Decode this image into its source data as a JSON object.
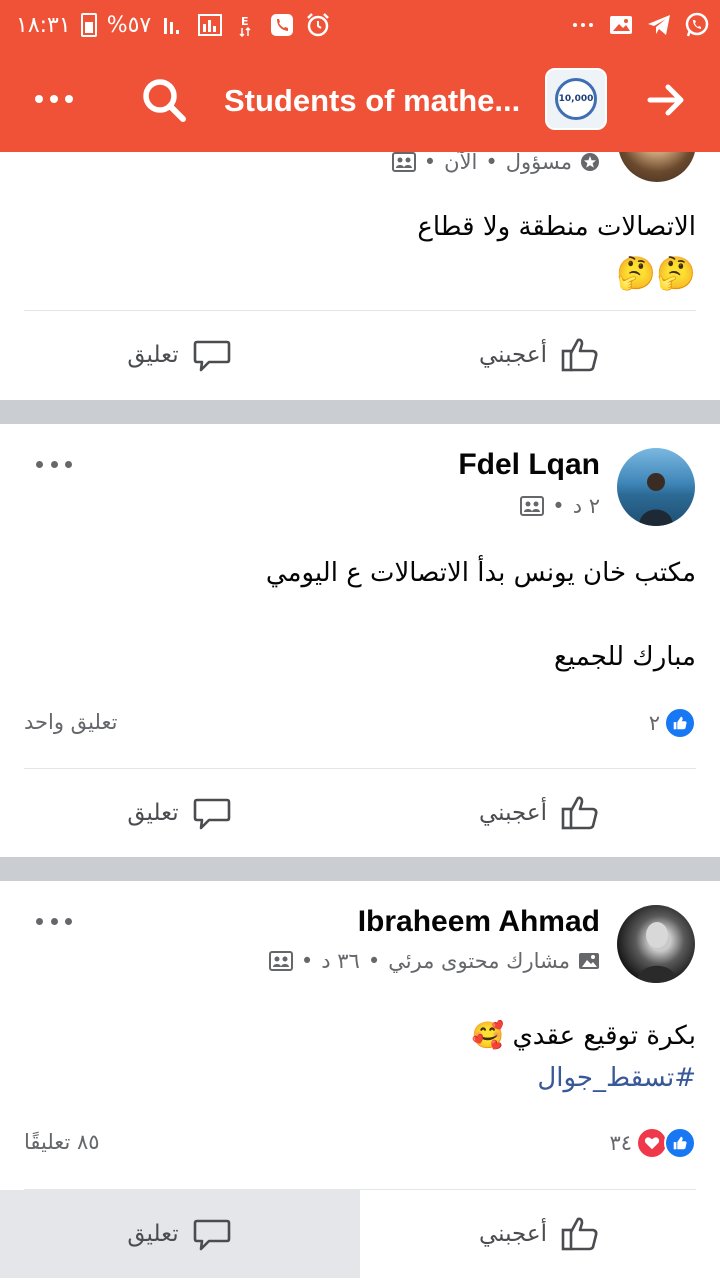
{
  "status_bar": {
    "time": "١٨:٣١",
    "battery": "%٥٧",
    "icons_left": [
      "battery-icon",
      "signal-icon",
      "data-icon",
      "network-e-icon",
      "phone-icon",
      "alarm-icon"
    ],
    "icons_right": [
      "more-dots-icon",
      "image-icon",
      "telegram-icon",
      "whatsapp-icon"
    ]
  },
  "app_bar": {
    "title": "Students of mathe...",
    "group_avatar_text": "10,000",
    "colors": {
      "brand": "#ef5236"
    }
  },
  "posts": [
    {
      "meta": {
        "role": "مسؤول",
        "time": "الآن"
      },
      "text": [
        "الاتصالات منطقة ولا قطاع",
        "🤔🤔"
      ],
      "actions": {
        "like": "أعجبني",
        "comment": "تعليق"
      }
    },
    {
      "author": "Fdel Lqan",
      "meta": {
        "time": "٢ د"
      },
      "text": [
        "مكتب خان يونس بدأ الاتصالات ع اليومي",
        "مبارك للجميع"
      ],
      "reactions": {
        "count": "٢"
      },
      "comments": "تعليق واحد",
      "actions": {
        "like": "أعجبني",
        "comment": "تعليق"
      }
    },
    {
      "author": "Ibraheem Ahmad",
      "meta": {
        "badge": "مشارك محتوى مرئي",
        "time": "٣٦ د"
      },
      "text": [
        "بكرة توقيع عقدي 🥰"
      ],
      "hashtag": "#تسقط_جوال",
      "reactions": {
        "count": "٣٤"
      },
      "comments": "٨٥ تعليقًا",
      "actions": {
        "like": "أعجبني",
        "comment": "تعليق"
      }
    }
  ]
}
